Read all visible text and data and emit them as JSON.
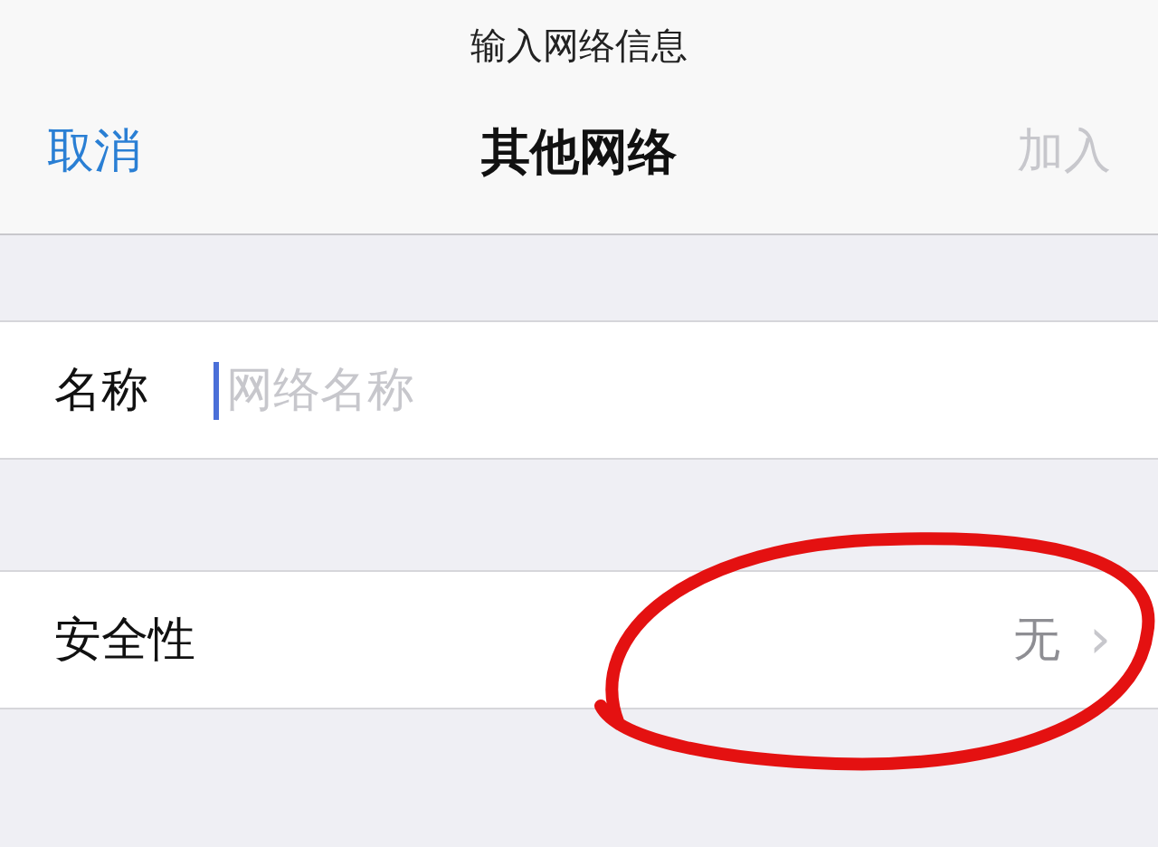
{
  "prompt": "输入网络信息",
  "nav": {
    "cancel": "取消",
    "title": "其他网络",
    "join": {
      "label": "加入",
      "disabled": true
    }
  },
  "name_row": {
    "label": "名称",
    "placeholder": "网络名称"
  },
  "security_row": {
    "label": "安全性",
    "value": "无",
    "chevron": "›"
  }
}
